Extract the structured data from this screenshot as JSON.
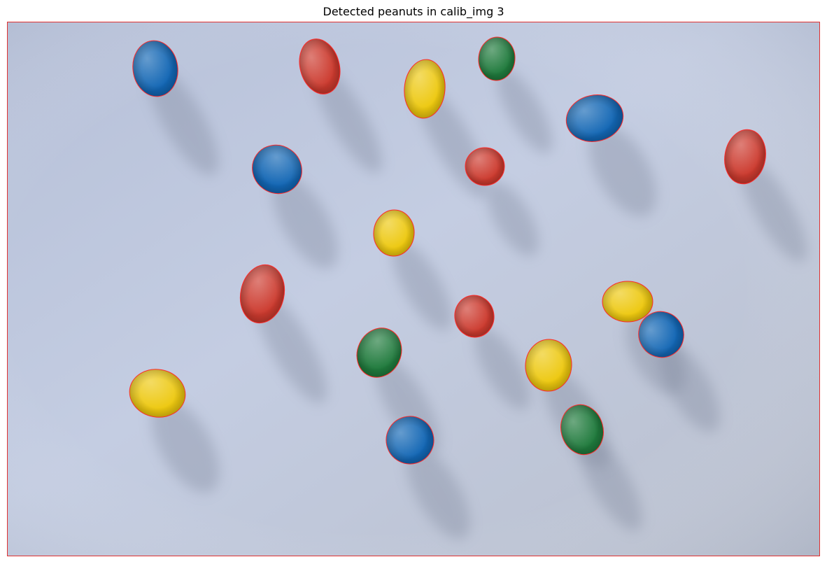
{
  "title": "Detected peanuts in calib_img 3",
  "colors": {
    "contour": "#ff2a2a",
    "background_light": "#c3cbe0",
    "background_dark": "#b4bacb",
    "peanut_blue": "#1266b4",
    "peanut_red": "#cc3a2e",
    "peanut_yellow": "#edc80e",
    "peanut_green": "#1f7a3c"
  },
  "peanuts": [
    {
      "color": "blue"
    },
    {
      "color": "red"
    },
    {
      "color": "yellow"
    },
    {
      "color": "green"
    },
    {
      "color": "blue"
    },
    {
      "color": "red"
    },
    {
      "color": "blue"
    },
    {
      "color": "red"
    },
    {
      "color": "yellow"
    },
    {
      "color": "red"
    },
    {
      "color": "red"
    },
    {
      "color": "yellow"
    },
    {
      "color": "blue"
    },
    {
      "color": "green"
    },
    {
      "color": "yellow"
    },
    {
      "color": "yellow"
    },
    {
      "color": "blue"
    },
    {
      "color": "green"
    }
  ]
}
